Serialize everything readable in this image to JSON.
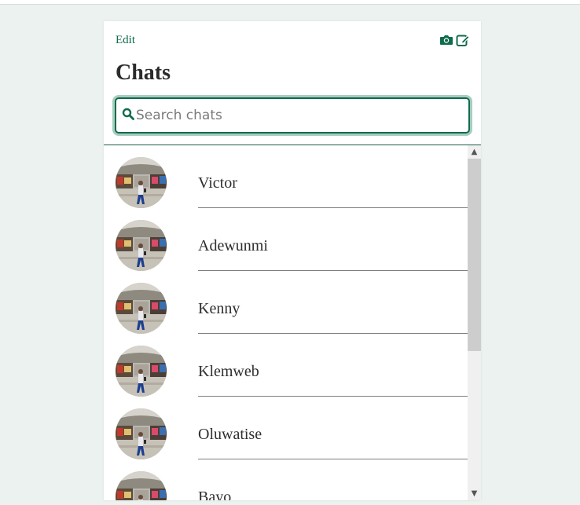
{
  "header": {
    "edit_label": "Edit",
    "title": "Chats",
    "icons": [
      "camera-icon",
      "compose-icon"
    ]
  },
  "search": {
    "placeholder": "Search chats",
    "value": ""
  },
  "chats": [
    {
      "name": "Victor"
    },
    {
      "name": "Adewunmi"
    },
    {
      "name": "Kenny"
    },
    {
      "name": "Klemweb"
    },
    {
      "name": "Oluwatise"
    },
    {
      "name": "Bayo"
    }
  ],
  "colors": {
    "accent": "#0e6b4d",
    "background": "#ecf2ef"
  }
}
